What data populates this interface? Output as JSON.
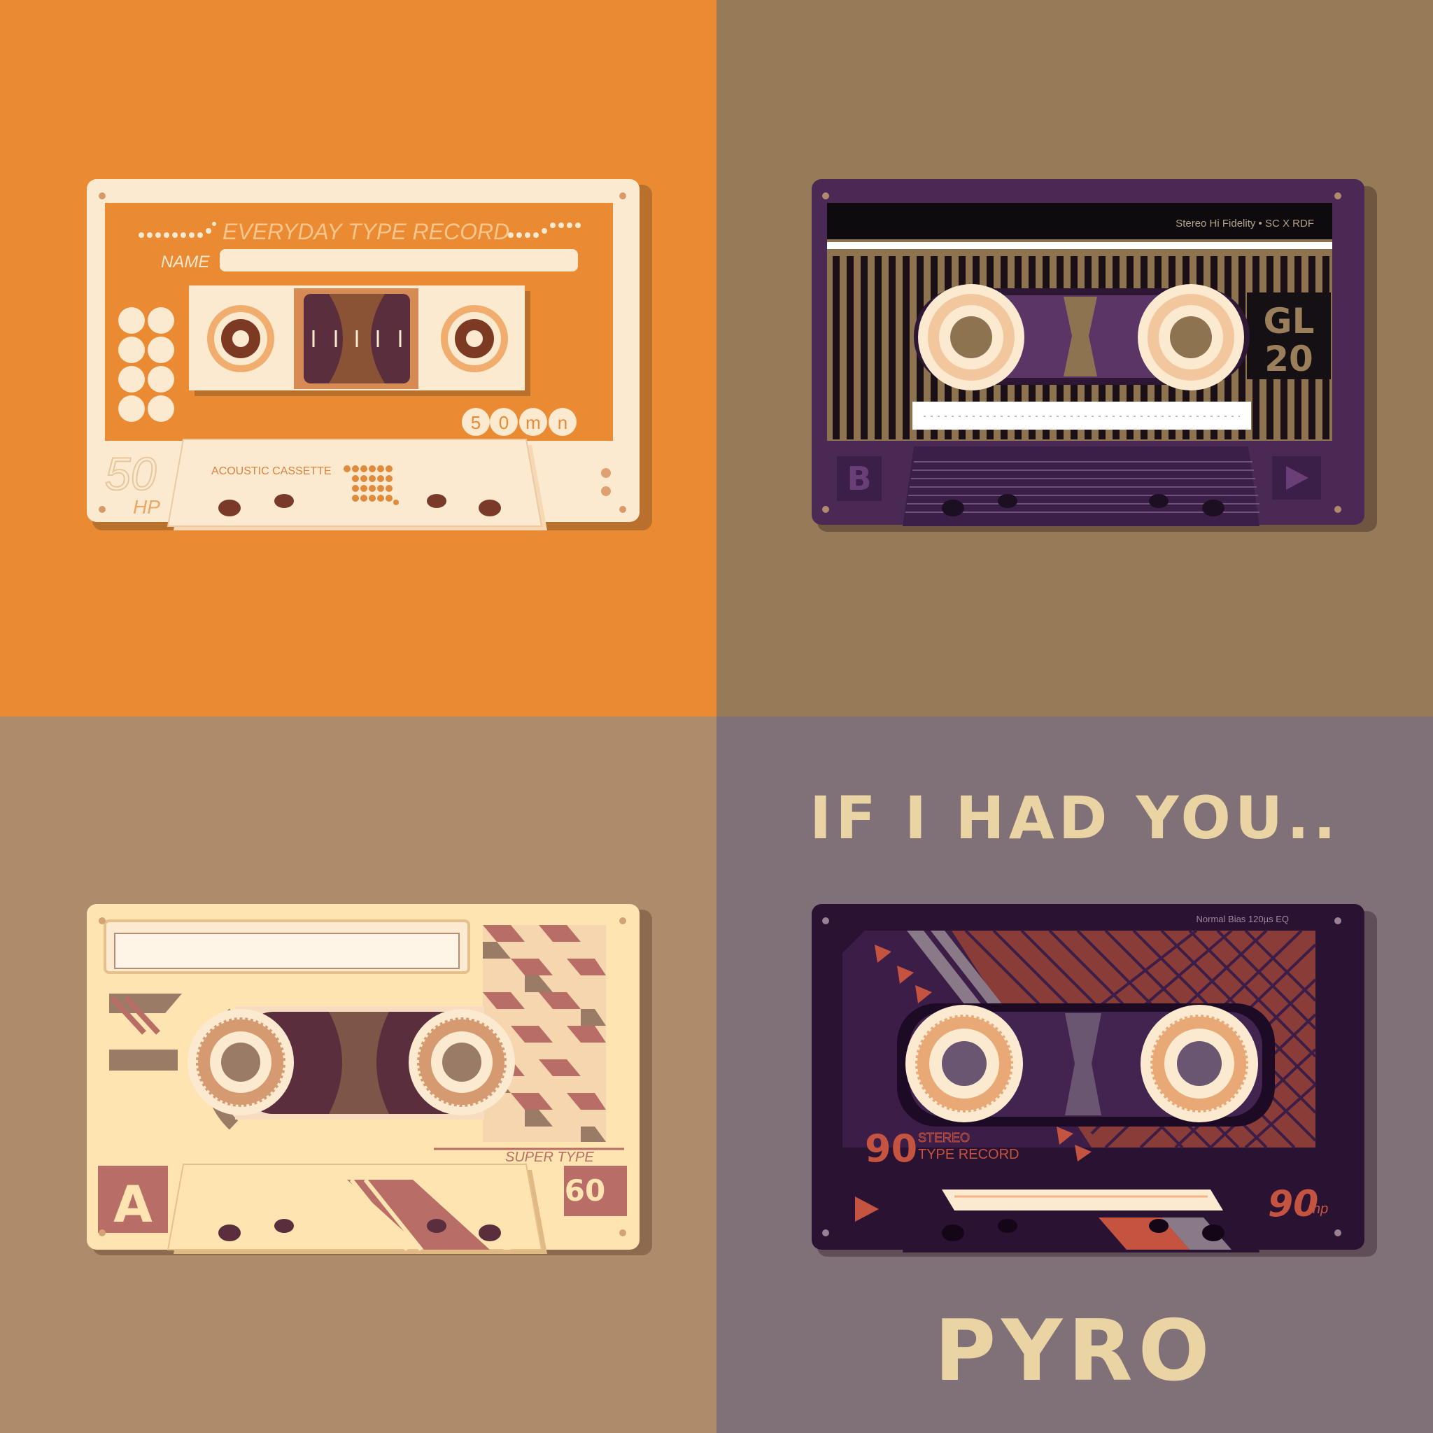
{
  "album": {
    "title": "IF I HAD YOU..",
    "artist": "PYRO"
  },
  "cassettes": {
    "top_left": {
      "brand": "EVERYDAY TYPE RECORD",
      "name_label": "NAME",
      "length": "50",
      "length_suffix": "HP",
      "subtitle": "ACOUSTIC CASSETTE",
      "badge": [
        "5",
        "0",
        "m",
        "n"
      ]
    },
    "top_right": {
      "header": "Stereo Hi Fidelity • SC X RDF",
      "model_top": "GL",
      "model_bottom": "20",
      "side": "B"
    },
    "bottom_left": {
      "type": "SUPER TYPE",
      "side": "A",
      "length": "60"
    },
    "bottom_right": {
      "header": "Normal Bias 120µs EQ",
      "length": "90",
      "stereo": "STEREO",
      "type": "TYPE RECORD",
      "hp": "90",
      "hp_suffix": "hp"
    }
  },
  "colors": {
    "orange": "#ea8a33",
    "khaki": "#977a58",
    "tan": "#ad8b6b",
    "mauve": "#807179",
    "cream": "#fbe9d0",
    "purple": "#3b1f48",
    "title": "#ead4a4"
  }
}
